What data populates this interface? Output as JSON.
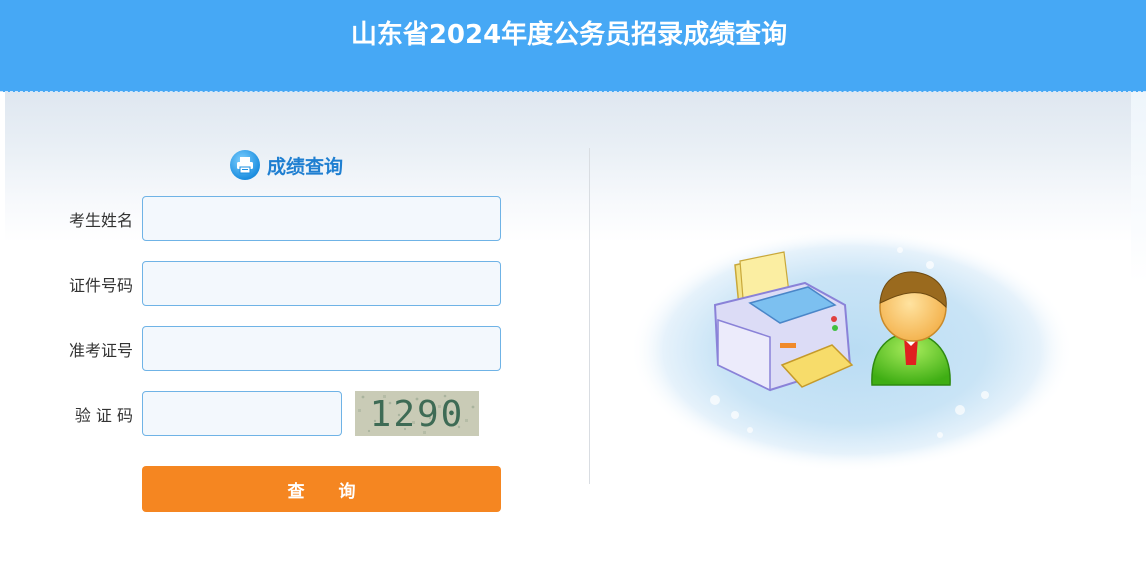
{
  "header": {
    "title": "山东省2024年度公务员招录成绩查询"
  },
  "form": {
    "title": "成绩查询",
    "fields": [
      {
        "label": "考生姓名",
        "value": "",
        "placeholder": ""
      },
      {
        "label": "证件号码",
        "value": "",
        "placeholder": ""
      },
      {
        "label": "准考证号",
        "value": "",
        "placeholder": ""
      },
      {
        "label": "验 证 码",
        "value": "",
        "placeholder": ""
      }
    ],
    "captcha_text": "1290",
    "submit_label": "查 询"
  },
  "colors": {
    "header_bg": "#46a8f5",
    "accent_blue": "#1f7fd1",
    "submit_bg": "#f58621"
  },
  "icons": {
    "form_title_icon": "printer-icon",
    "illustration": "printer-person-illustration"
  }
}
